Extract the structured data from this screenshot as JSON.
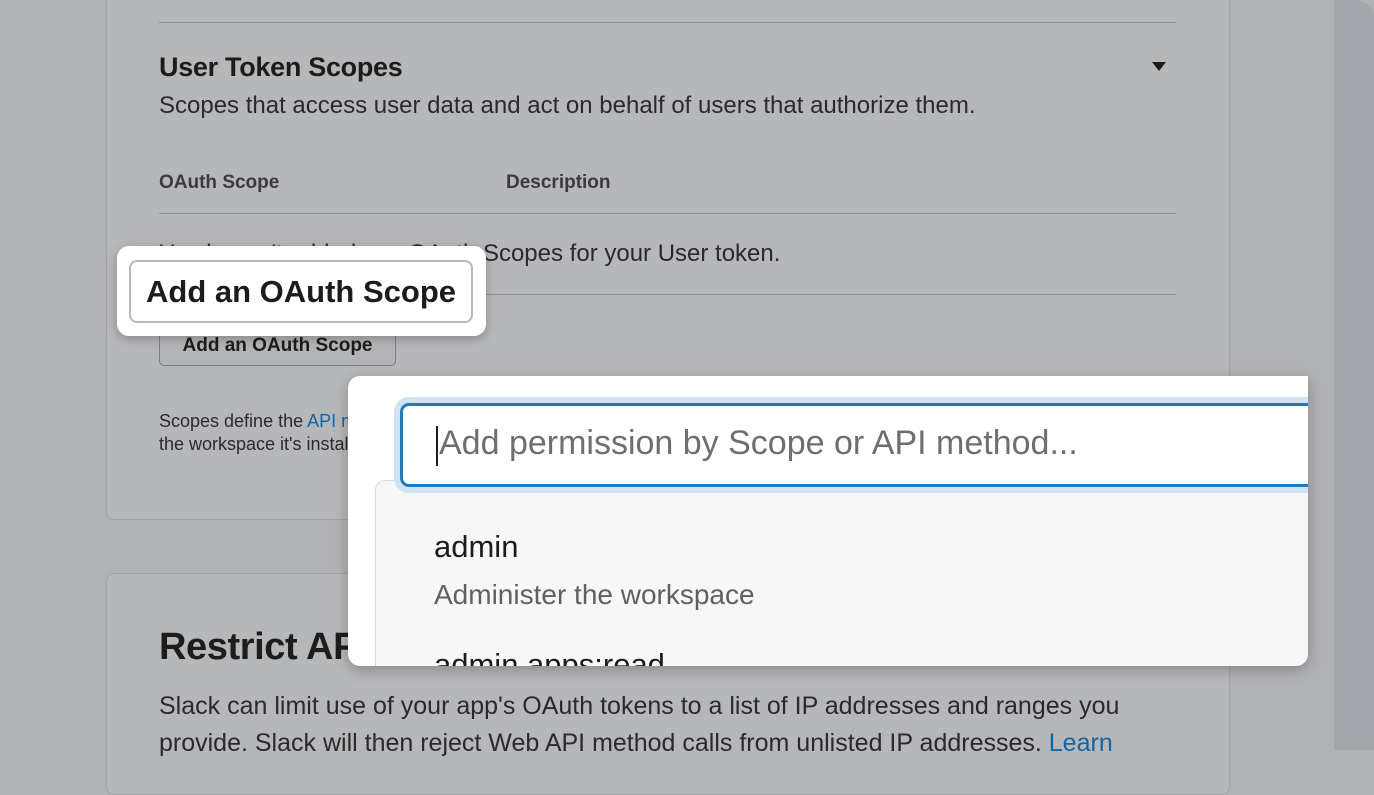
{
  "user_token_scopes": {
    "title": "User Token Scopes",
    "description": "Scopes that access user data and act on behalf of users that authorize them.",
    "columns": [
      "OAuth Scope",
      "Description"
    ],
    "empty_state": "You haven't added any OAuth Scopes for your User token.",
    "add_button_label": "Add an OAuth Scope",
    "footnote_prefix": "Scopes define the ",
    "footnote_link": "API methods",
    "footnote_line2": "the workspace it's installed in."
  },
  "callout": {
    "button_label": "Add an OAuth Scope"
  },
  "scope_picker": {
    "placeholder": "Add permission by Scope or API method...",
    "options": [
      {
        "name": "admin",
        "description": "Administer the workspace"
      },
      {
        "name": "admin.apps:read",
        "description": ""
      }
    ]
  },
  "restrict_api": {
    "title": "Restrict API Token Usage",
    "description": "Slack can limit use of your app's OAuth tokens to a list of IP addresses and ranges you provide. Slack will then reject Web API method calls from unlisted IP addresses.",
    "link": "Learn"
  }
}
